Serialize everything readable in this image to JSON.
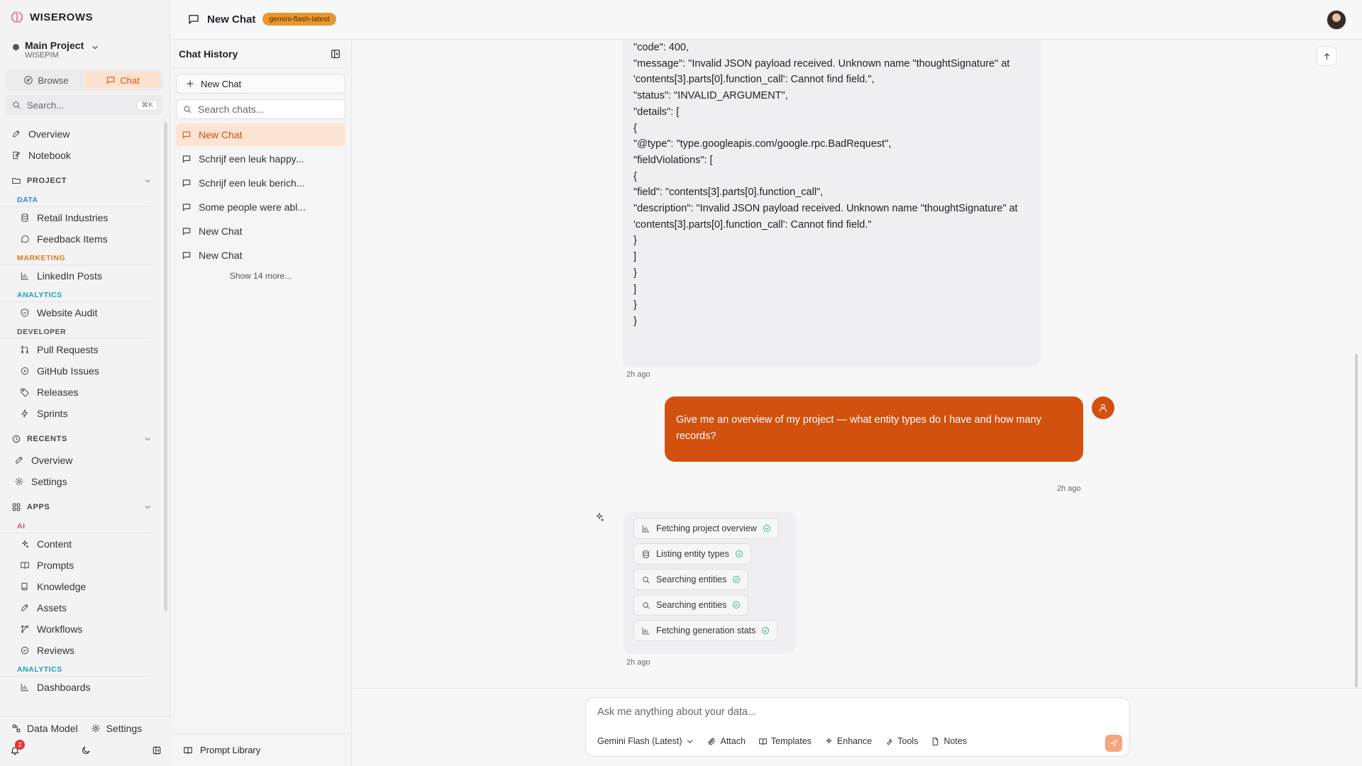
{
  "app": {
    "brand": "WISEROWS"
  },
  "project": {
    "name": "Main Project",
    "workspace": "WISEPIM"
  },
  "mode_toggle": {
    "browse": "Browse",
    "chat": "Chat"
  },
  "sidebar_search": {
    "placeholder": "Search...",
    "shortcut": "⌘K"
  },
  "nav": {
    "top": [
      {
        "label": "Overview",
        "icon": "rocket-icon"
      },
      {
        "label": "Notebook",
        "icon": "notebook-icon"
      }
    ],
    "project": {
      "label": "PROJECT",
      "categories": [
        {
          "label": "DATA",
          "items": [
            "Retail Industries",
            "Feedback Items"
          ]
        },
        {
          "label": "MARKETING",
          "items": [
            "LinkedIn Posts"
          ]
        },
        {
          "label": "ANALYTICS",
          "items": [
            "Website Audit"
          ]
        },
        {
          "label": "DEVELOPER",
          "items": [
            "Pull Requests",
            "GitHub Issues",
            "Releases",
            "Sprints"
          ]
        }
      ]
    },
    "recents": {
      "label": "RECENTS",
      "items": [
        "Overview",
        "Settings"
      ]
    },
    "apps": {
      "label": "APPS",
      "ai_label": "AI",
      "ai_items": [
        "Content",
        "Prompts",
        "Knowledge",
        "Assets",
        "Workflows",
        "Reviews"
      ],
      "analytics_label": "ANALYTICS",
      "analytics_items": [
        "Dashboards"
      ]
    }
  },
  "sidebar_bottom": {
    "data_model": "Data Model",
    "settings": "Settings",
    "notifications_count": "2"
  },
  "header": {
    "title": "New Chat",
    "model_badge": "gemini-flash-latest"
  },
  "history": {
    "title": "Chat History",
    "new_chat": "New Chat",
    "search_placeholder": "Search chats...",
    "items": [
      "New Chat",
      "Schrijf een leuk happy...",
      "Schrijf een leuk berich...",
      "Some people were abl...",
      "New Chat",
      "New Chat"
    ],
    "show_more": "Show 14 more...",
    "prompt_library": "Prompt Library"
  },
  "messages": {
    "error_lines": [
      "\"code\": 400,",
      "\"message\": \"Invalid JSON payload received. Unknown name \"thoughtSignature\" at 'contents[3].parts[0].function_call': Cannot find field.\",",
      "\"status\": \"INVALID_ARGUMENT\",",
      "\"details\": [",
      "{",
      "\"@type\": \"type.googleapis.com/google.rpc.BadRequest\",",
      "\"fieldViolations\": [",
      "{",
      "\"field\": \"contents[3].parts[0].function_call\",",
      "\"description\": \"Invalid JSON payload received. Unknown name \"thoughtSignature\" at 'contents[3].parts[0].function_call': Cannot find field.\"",
      "}",
      "]",
      "}",
      "]",
      "}",
      "}"
    ],
    "error_time": "2h ago",
    "user_text": "Give me an overview of my project — what entity types do I have and how many records?",
    "user_time": "2h ago",
    "tool_steps": [
      {
        "label": "Fetching project overview",
        "icon": "bar-chart-icon"
      },
      {
        "label": "Listing entity types",
        "icon": "database-icon"
      },
      {
        "label": "Searching entities",
        "icon": "search-icon"
      },
      {
        "label": "Searching entities",
        "icon": "search-icon"
      },
      {
        "label": "Fetching generation stats",
        "icon": "bar-chart-icon"
      }
    ],
    "tool_time": "2h ago"
  },
  "composer": {
    "placeholder": "Ask me anything about your data...",
    "model": "Gemini Flash (Latest)",
    "attach": "Attach",
    "templates": "Templates",
    "enhance": "Enhance",
    "tools": "Tools",
    "notes": "Notes"
  },
  "colors": {
    "accent": "#d2510f",
    "accent_soft": "#fde3d3",
    "badge": "#e9962e",
    "success": "#2fb37a"
  }
}
